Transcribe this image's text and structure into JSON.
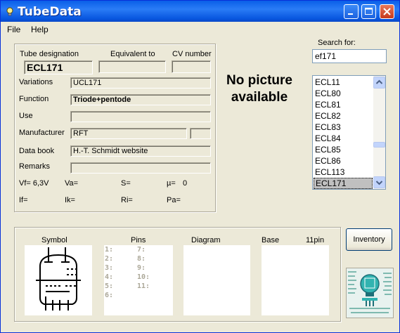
{
  "window": {
    "title": "TubeData"
  },
  "menu": {
    "file": "File",
    "help": "Help"
  },
  "search": {
    "label": "Search for:",
    "value": "ef171"
  },
  "headers": {
    "designation": "Tube designation",
    "equivalent": "Equivalent to",
    "cv": "CV number"
  },
  "tube": {
    "designation": "ECL171",
    "equivalent": "",
    "cv": "",
    "variations_label": "Variations",
    "variations": "UCL171",
    "function_label": "Function",
    "function": "Triode+pentode",
    "use_label": "Use",
    "use": "",
    "manufacturer_label": "Manufacturer",
    "manufacturer": "RFT",
    "manufacturer_code": "",
    "databook_label": "Data book",
    "databook": "H.-T. Schmidt website",
    "remarks_label": "Remarks",
    "remarks": ""
  },
  "params": {
    "vf": "Vf= 6,3V",
    "va": "Va=",
    "s": "S=",
    "mu": "µ=",
    "mu_value": "0",
    "if": "If=",
    "ik": "Ik=",
    "ri": "Ri=",
    "pa": "Pa="
  },
  "picture": {
    "message": "No picture available"
  },
  "list": {
    "items": [
      "ECL11",
      "ECL80",
      "ECL81",
      "ECL82",
      "ECL83",
      "ECL84",
      "ECL85",
      "ECL86",
      "ECL113",
      "ECL171"
    ],
    "selected": "ECL171"
  },
  "bottom": {
    "symbol": "Symbol",
    "pins": "Pins",
    "diagram": "Diagram",
    "base": "Base",
    "base_pins": "11pin"
  },
  "pins": {
    "left": [
      "1:",
      "2:",
      "3:",
      "4:",
      "5:",
      "6:"
    ],
    "right": [
      "7:",
      "8:",
      "9:",
      "10:",
      "11:"
    ]
  },
  "buttons": {
    "inventory": "Inventory"
  },
  "icons": {
    "app": "lightbulb-icon",
    "minimize": "minimize-icon",
    "maximize": "maximize-icon",
    "close": "close-icon",
    "up": "arrow-up-icon",
    "down": "arrow-down-icon"
  }
}
